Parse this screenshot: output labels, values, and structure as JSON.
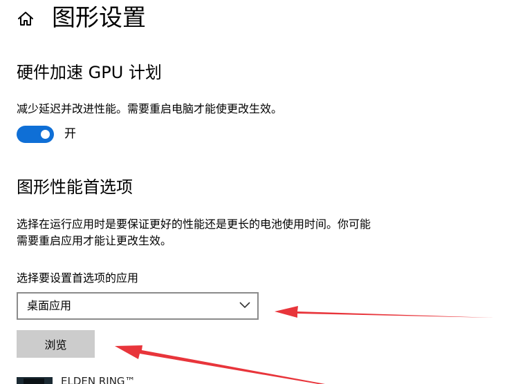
{
  "header": {
    "title": "图形设置",
    "home_icon": "home-icon"
  },
  "gpu_scheduling": {
    "title": "硬件加速 GPU 计划",
    "description": "减少延迟并改进性能。需要重启电脑才能使更改生效。",
    "toggle_state": "on",
    "toggle_label": "开"
  },
  "graphics_preference": {
    "title": "图形性能首选项",
    "description_line1": "选择在运行应用时是要保证更好的性能还是更长的电池使用时间。你可能",
    "description_line2": "需要重启应用才能让更改生效。",
    "select_label": "选择要设置首选项的应用",
    "selected_app_type": "桌面应用",
    "browse_label": "浏览"
  },
  "app_list": {
    "items": [
      {
        "name": "ELDEN RING™"
      }
    ]
  },
  "colors": {
    "accent": "#0f6fd6",
    "annotation_arrow": "#e8353b",
    "button_bg": "#cccccc",
    "dropdown_border": "#8a8a8a"
  }
}
